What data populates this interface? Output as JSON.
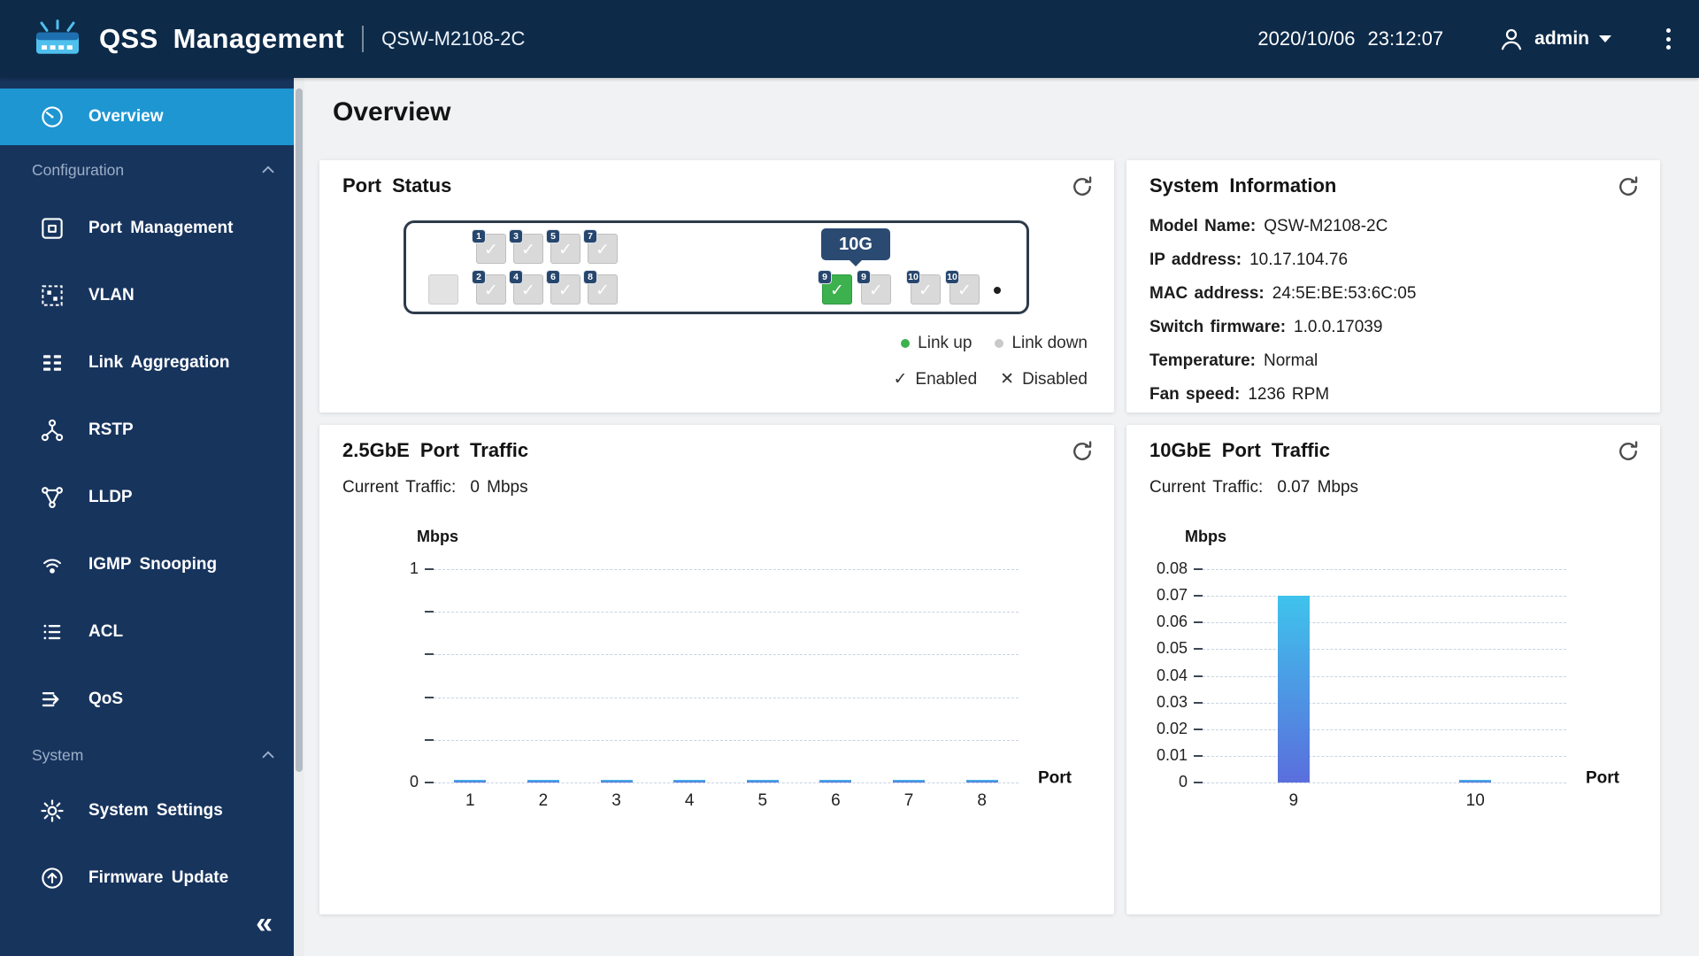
{
  "header": {
    "app_title": "QSS Management",
    "device_model": "QSW-M2108-2C",
    "date": "2020/10/06",
    "time": "23:12:07",
    "username": "admin"
  },
  "sidebar": {
    "overview": "Overview",
    "sections": {
      "configuration": "Configuration",
      "system": "System"
    },
    "config_items": [
      "Port Management",
      "VLAN",
      "Link Aggregation",
      "RSTP",
      "LLDP",
      "IGMP Snooping",
      "ACL",
      "QoS"
    ],
    "system_items": [
      "System Settings",
      "Firmware Update"
    ]
  },
  "page": {
    "title": "Overview"
  },
  "port_status": {
    "title": "Port Status",
    "tooltip": "10G",
    "ports": {
      "top": [
        "1",
        "3",
        "5",
        "7"
      ],
      "bottom": [
        "2",
        "4",
        "6",
        "8"
      ],
      "ten_g": [
        "9",
        "9",
        "10",
        "10"
      ]
    },
    "legend": {
      "link_up": "Link up",
      "link_down": "Link down",
      "enabled": "Enabled",
      "disabled": "Disabled"
    }
  },
  "system_info": {
    "title": "System Information",
    "rows": [
      {
        "label": "Model Name:",
        "value": "QSW-M2108-2C"
      },
      {
        "label": "IP address:",
        "value": "10.17.104.76"
      },
      {
        "label": "MAC address:",
        "value": "24:5E:BE:53:6C:05"
      },
      {
        "label": "Switch firmware:",
        "value": "1.0.0.17039"
      },
      {
        "label": "Temperature:",
        "value": "Normal"
      },
      {
        "label": "Fan speed:",
        "value": "1236 RPM"
      }
    ]
  },
  "chart_data": [
    {
      "type": "bar",
      "title": "2.5GbE Port Traffic",
      "current_label": "Current Traffic:",
      "current_value": "0 Mbps",
      "ylabel": "Mbps",
      "xlabel": "Port",
      "categories": [
        "1",
        "2",
        "3",
        "4",
        "5",
        "6",
        "7",
        "8"
      ],
      "values": [
        0,
        0,
        0,
        0,
        0,
        0,
        0,
        0
      ],
      "ylim": [
        0,
        1
      ],
      "grid": "dashed-horizontal",
      "yticks": [
        {
          "value": 1,
          "label": "1"
        },
        {
          "value": 0.8,
          "label": ""
        },
        {
          "value": 0.6,
          "label": ""
        },
        {
          "value": 0.4,
          "label": ""
        },
        {
          "value": 0.2,
          "label": ""
        },
        {
          "value": 0,
          "label": "0"
        }
      ]
    },
    {
      "type": "bar",
      "title": "10GbE Port Traffic",
      "current_label": "Current Traffic:",
      "current_value": "0.07 Mbps",
      "ylabel": "Mbps",
      "xlabel": "Port",
      "categories": [
        "9",
        "10"
      ],
      "values": [
        0.07,
        0.001
      ],
      "ylim": [
        0,
        0.08
      ],
      "grid": "dashed-horizontal",
      "yticks": [
        {
          "value": 0.08,
          "label": "0.08"
        },
        {
          "value": 0.07,
          "label": "0.07"
        },
        {
          "value": 0.06,
          "label": "0.06"
        },
        {
          "value": 0.05,
          "label": "0.05"
        },
        {
          "value": 0.04,
          "label": "0.04"
        },
        {
          "value": 0.03,
          "label": "0.03"
        },
        {
          "value": 0.02,
          "label": "0.02"
        },
        {
          "value": 0.01,
          "label": "0.01"
        },
        {
          "value": 0,
          "label": "0"
        }
      ]
    }
  ],
  "icons": {
    "check": "✓",
    "cross": "✕",
    "collapse": "«"
  },
  "colors": {
    "header_bg": "#0D2A49",
    "sidebar_bg": "#17345D",
    "active_item_blue": "#1E96D2",
    "link_up_green": "#3CB14E",
    "link_down_gray": "#C9C9C9",
    "bar_gradient_top": "#3FC3EC",
    "bar_gradient_bottom": "#5A6EDC"
  }
}
